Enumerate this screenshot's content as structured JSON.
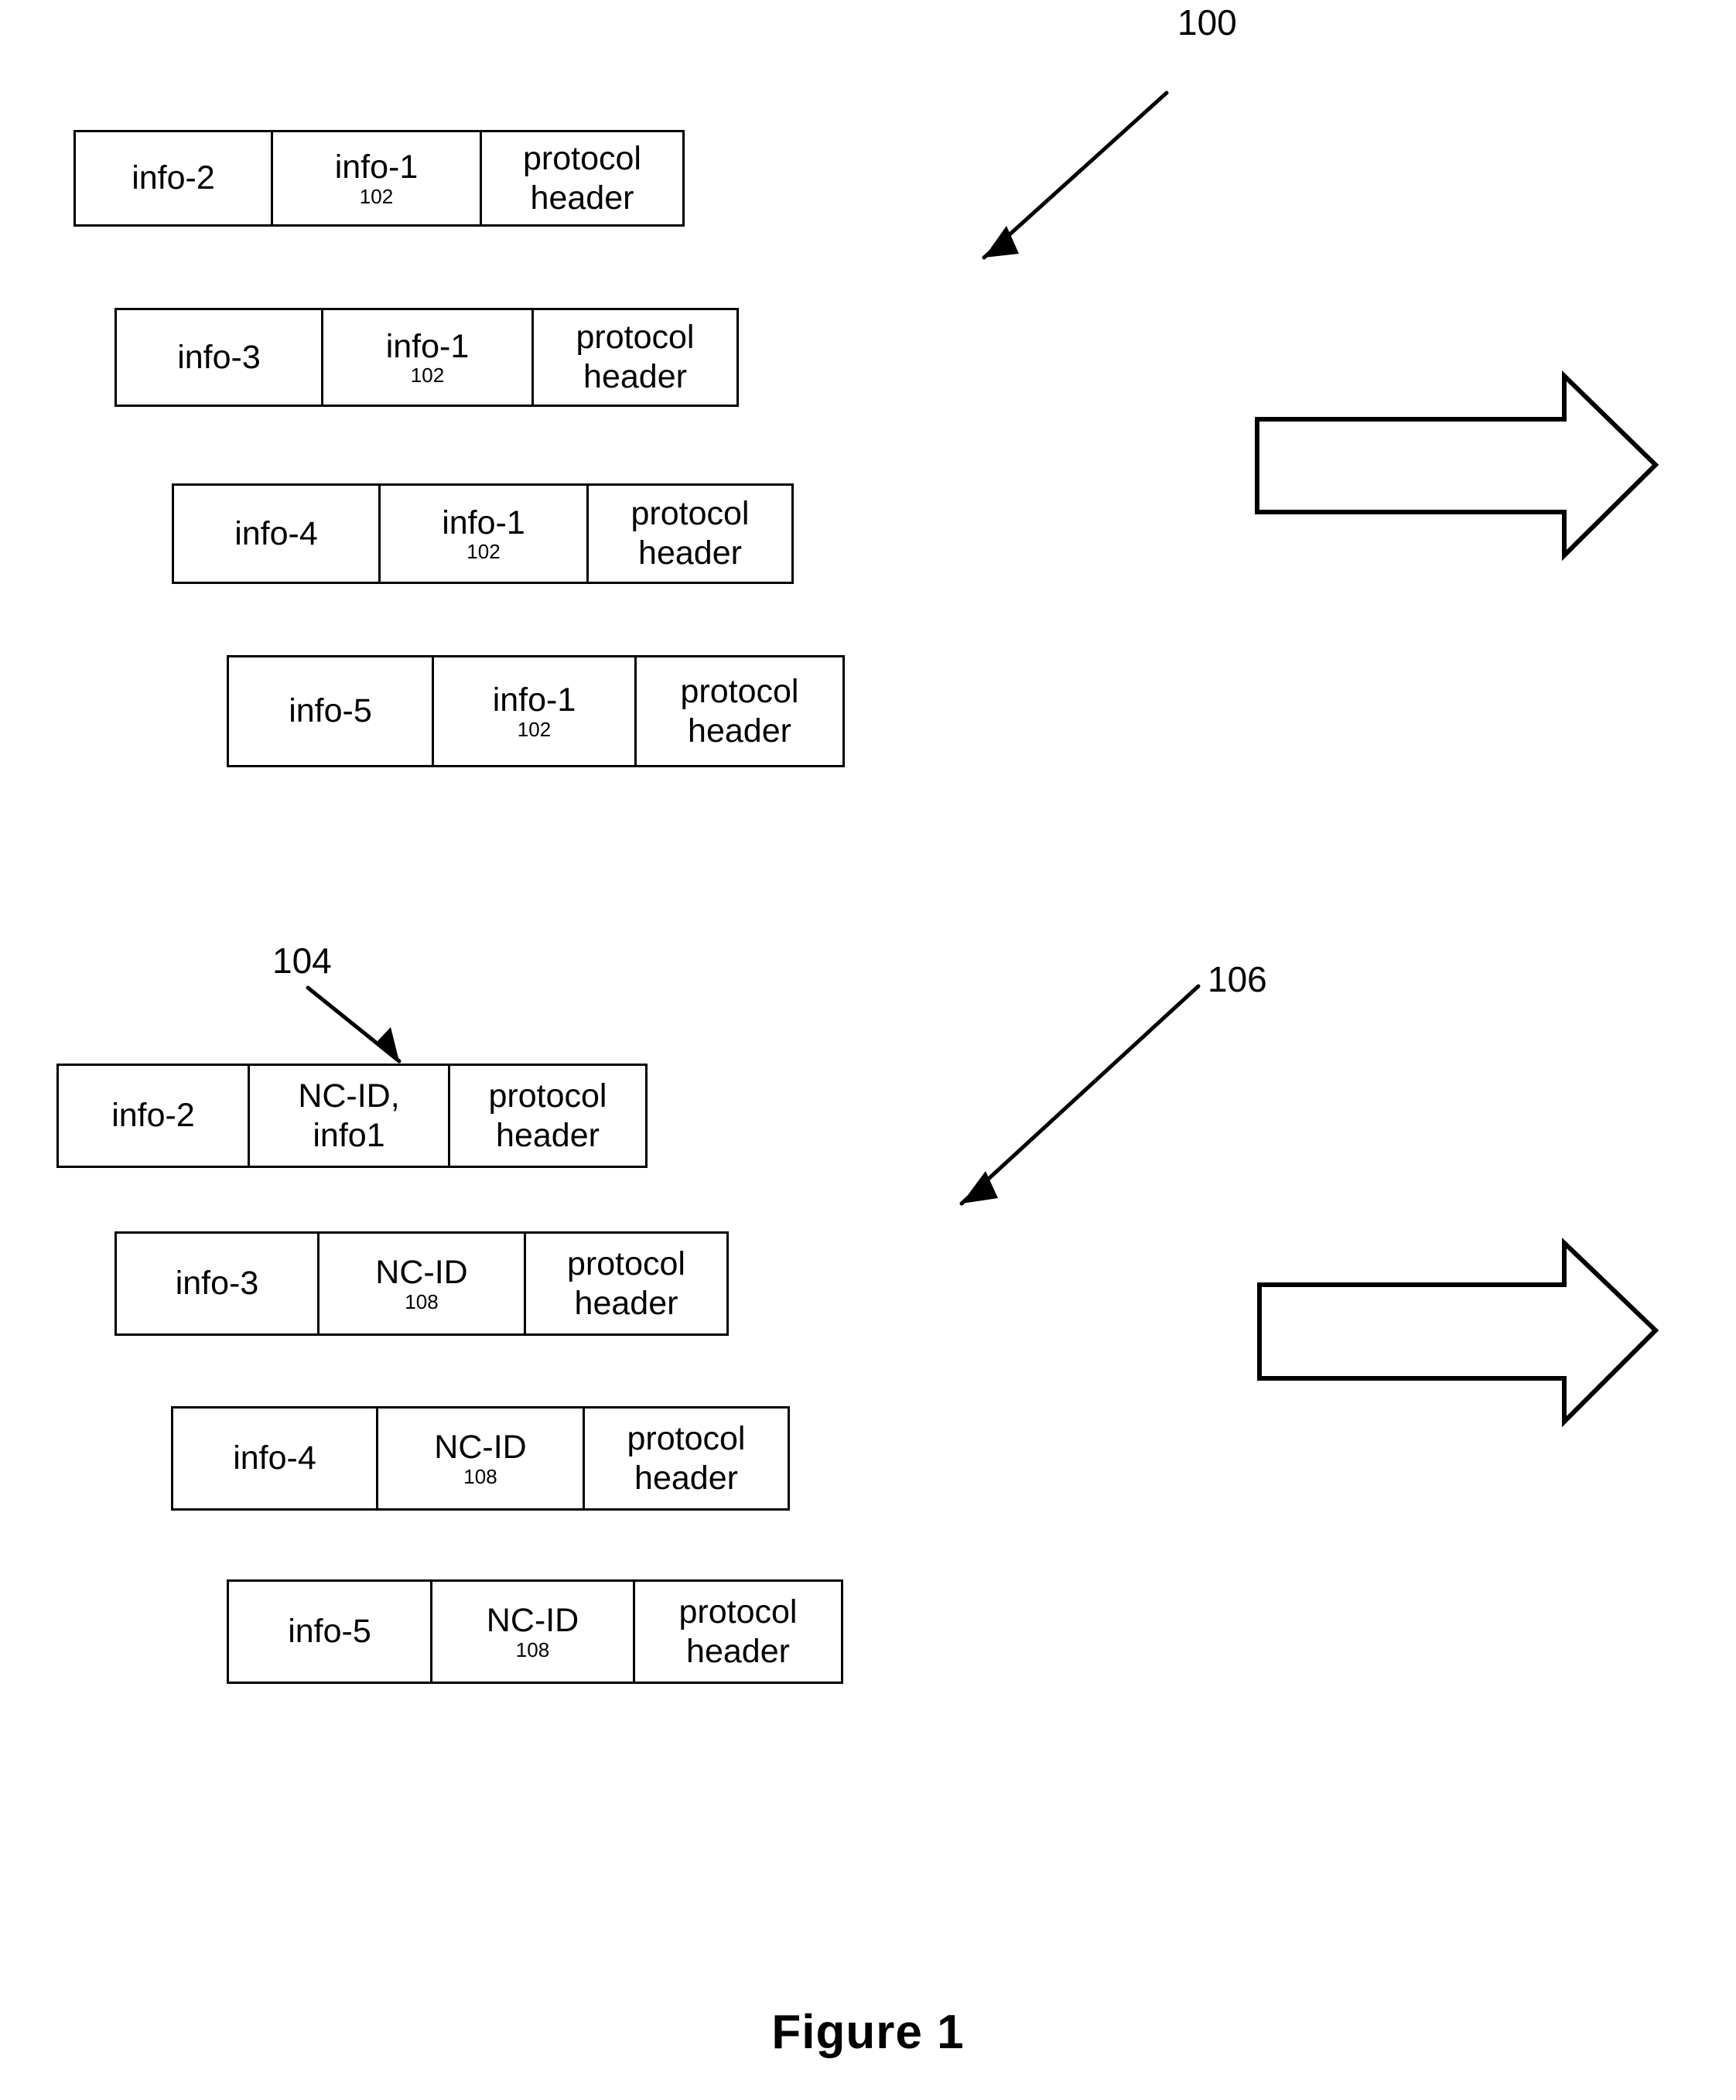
{
  "figure": {
    "caption": "Figure 1",
    "reference_numerals": {
      "group_top": "100",
      "nc_id_callout": "104",
      "group_bottom": "106",
      "info1_subscript": "102",
      "ncid_subscript": "108"
    }
  },
  "groups": [
    {
      "id": "group-top",
      "ref": "100",
      "packets": [
        {
          "cells": [
            {
              "main": "info-2",
              "sub": ""
            },
            {
              "main": "info-1",
              "sub": "102"
            },
            {
              "main": "protocol\nheader",
              "sub": ""
            }
          ]
        },
        {
          "cells": [
            {
              "main": "info-3",
              "sub": ""
            },
            {
              "main": "info-1",
              "sub": "102"
            },
            {
              "main": "protocol\nheader",
              "sub": ""
            }
          ]
        },
        {
          "cells": [
            {
              "main": "info-4",
              "sub": ""
            },
            {
              "main": "info-1",
              "sub": "102"
            },
            {
              "main": "protocol\nheader",
              "sub": ""
            }
          ]
        },
        {
          "cells": [
            {
              "main": "info-5",
              "sub": ""
            },
            {
              "main": "info-1",
              "sub": "102"
            },
            {
              "main": "protocol\nheader",
              "sub": ""
            }
          ]
        }
      ]
    },
    {
      "id": "group-bottom",
      "ref": "106",
      "packets": [
        {
          "cells": [
            {
              "main": "info-2",
              "sub": ""
            },
            {
              "main": "NC-ID,\ninfo1",
              "sub": ""
            },
            {
              "main": "protocol\nheader",
              "sub": ""
            }
          ]
        },
        {
          "cells": [
            {
              "main": "info-3",
              "sub": ""
            },
            {
              "main": "NC-ID",
              "sub": "108"
            },
            {
              "main": "protocol\nheader",
              "sub": ""
            }
          ]
        },
        {
          "cells": [
            {
              "main": "info-4",
              "sub": ""
            },
            {
              "main": "NC-ID",
              "sub": "108"
            },
            {
              "main": "protocol\nheader",
              "sub": ""
            }
          ]
        },
        {
          "cells": [
            {
              "main": "info-5",
              "sub": ""
            },
            {
              "main": "NC-ID",
              "sub": "108"
            },
            {
              "main": "protocol\nheader",
              "sub": ""
            }
          ]
        }
      ]
    }
  ],
  "block_arrows": [
    {
      "name": "block-arrow-top",
      "direction": "right"
    },
    {
      "name": "block-arrow-bottom",
      "direction": "right"
    }
  ],
  "colors": {
    "ink": "#000000",
    "paper": "#ffffff"
  }
}
